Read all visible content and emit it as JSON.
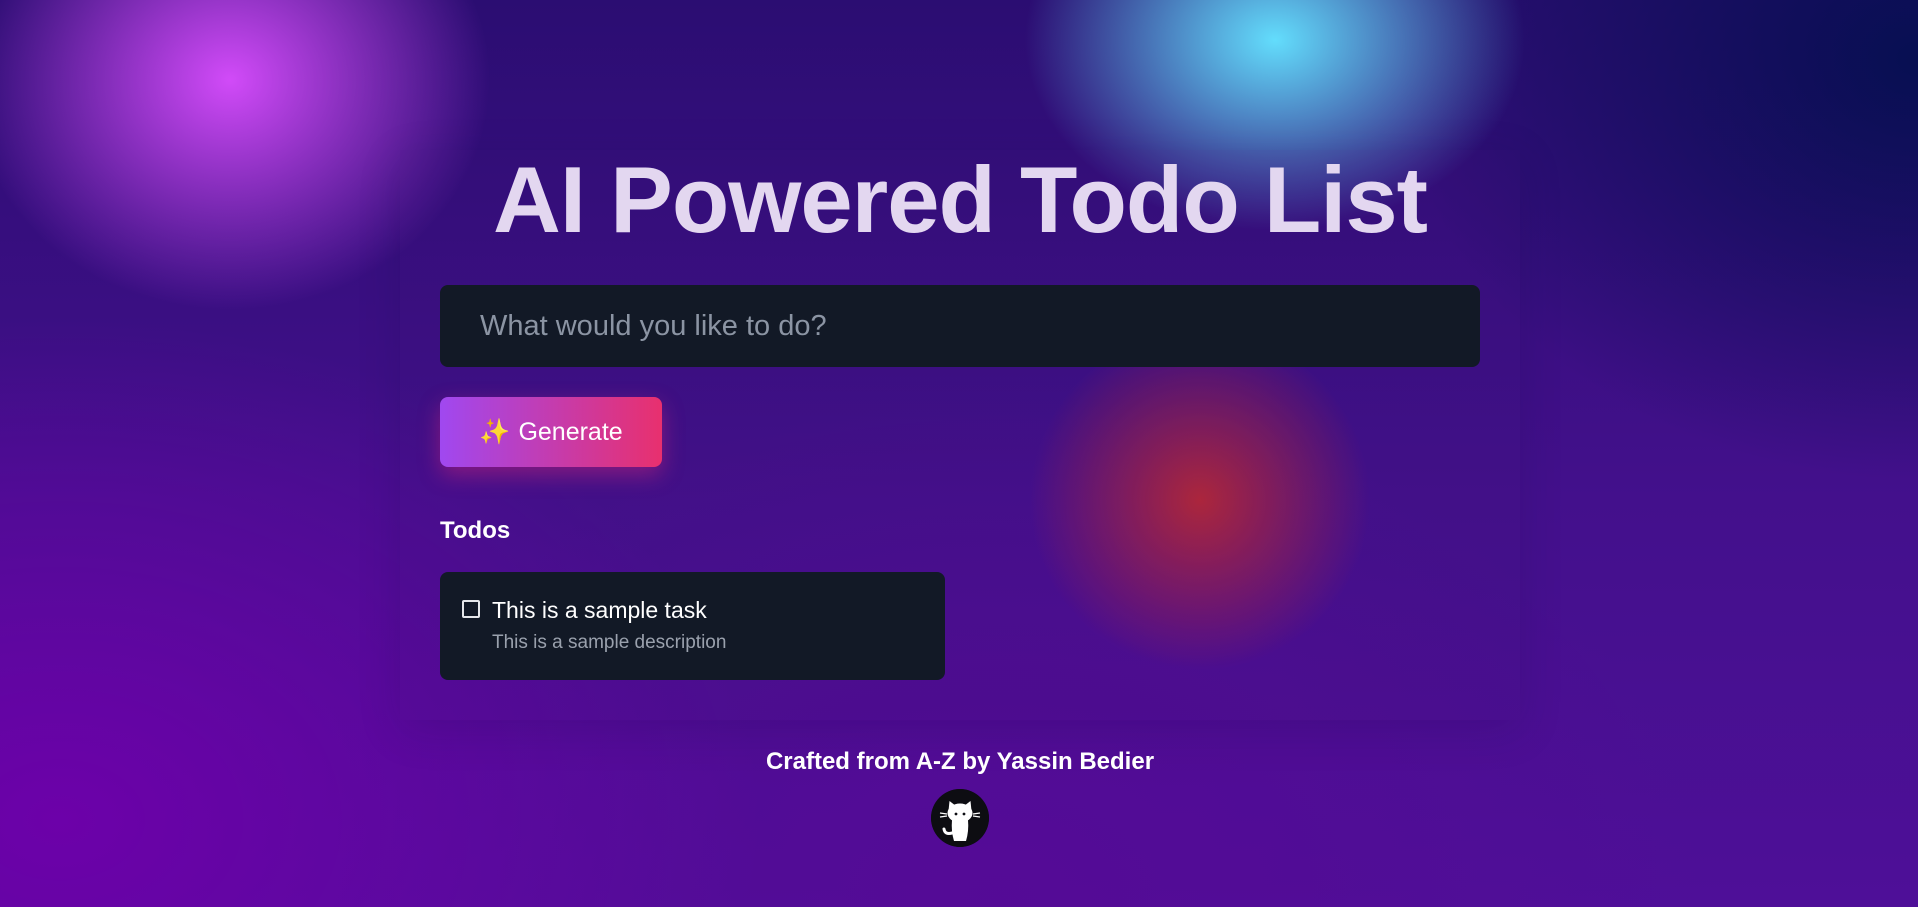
{
  "header": {
    "title": "AI Powered Todo List"
  },
  "form": {
    "input_placeholder": "What would you like to do?",
    "input_value": "",
    "generate_icon": "✨",
    "generate_label": "Generate"
  },
  "todos": {
    "heading": "Todos",
    "items": [
      {
        "title": "This is a sample task",
        "description": "This is a sample description",
        "checked": false
      }
    ]
  },
  "footer": {
    "credit": "Crafted from A-Z by Yassin Bedier",
    "github_icon": "github-octocat-icon"
  },
  "colors": {
    "card_background": "#121926",
    "button_gradient_start": "#a048f0",
    "button_gradient_end": "#e8306e"
  }
}
